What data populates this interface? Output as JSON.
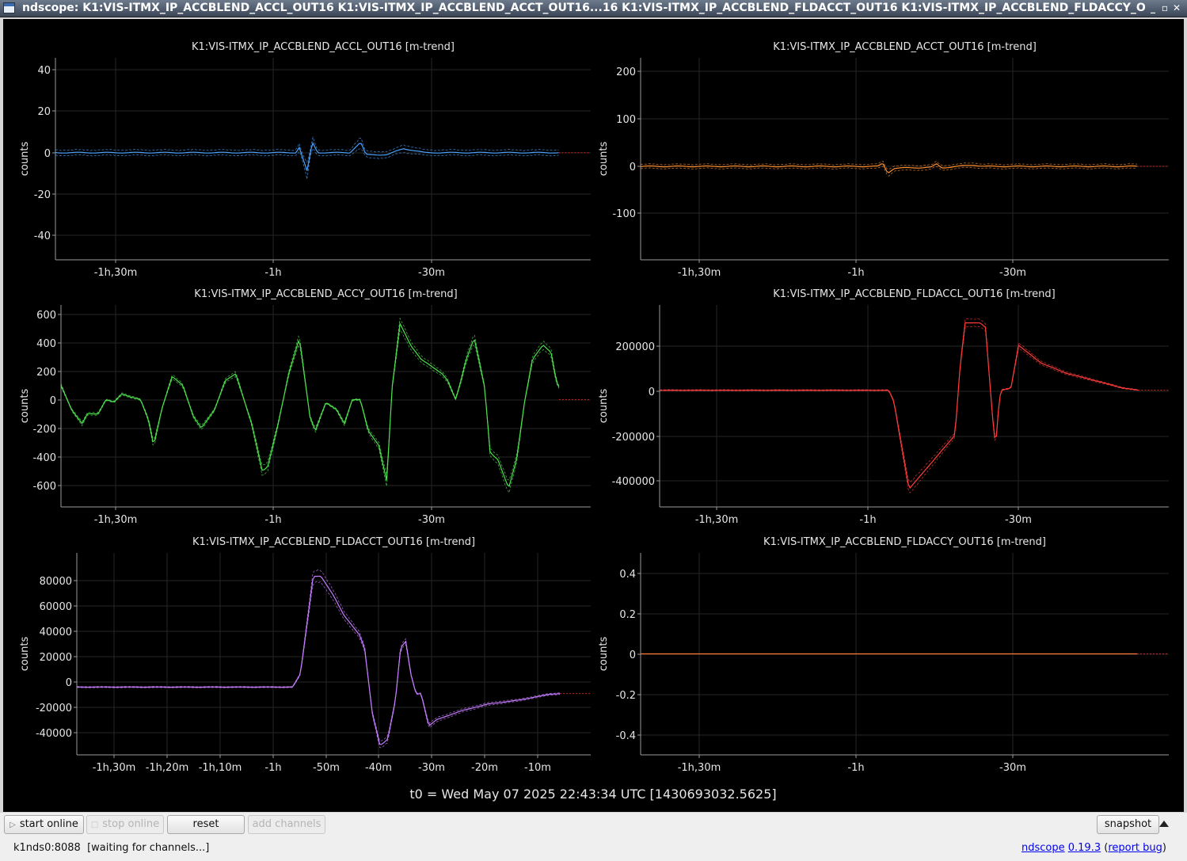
{
  "window": {
    "title": "ndscope: K1:VIS-ITMX_IP_ACCBLEND_ACCL_OUT16 K1:VIS-ITMX_IP_ACCBLEND_ACCT_OUT16...16 K1:VIS-ITMX_IP_ACCBLEND_FLDACCT_OUT16 K1:VIS-ITMX_IP_ACCBLEND_FLDACCY_OUT16",
    "minimize_glyph": "_",
    "maximize_glyph": "▫",
    "close_glyph": "✕",
    "icon": "app-window-icon"
  },
  "plots": [
    {
      "id": "accl",
      "title": "K1:VIS-ITMX_IP_ACCBLEND_ACCL_OUT16 [m-trend]",
      "ylabel": "counts",
      "color": "#4aa3ff",
      "yticks": [
        {
          "v": 40,
          "label": "40"
        },
        {
          "v": 20,
          "label": "20"
        },
        {
          "v": 0,
          "label": "0"
        },
        {
          "v": -20,
          "label": "-20"
        },
        {
          "v": -40,
          "label": "-40"
        }
      ],
      "xticks": [
        "-1h,30m",
        "-1h",
        "-30m"
      ]
    },
    {
      "id": "acct",
      "title": "K1:VIS-ITMX_IP_ACCBLEND_ACCT_OUT16 [m-trend]",
      "ylabel": "counts",
      "color": "#ff8c2a",
      "yticks": [
        {
          "v": 200,
          "label": "200"
        },
        {
          "v": 100,
          "label": "100"
        },
        {
          "v": 0,
          "label": "0"
        },
        {
          "v": -100,
          "label": "-100"
        }
      ],
      "xticks": [
        "-1h,30m",
        "-1h",
        "-30m"
      ]
    },
    {
      "id": "accy",
      "title": "K1:VIS-ITMX_IP_ACCBLEND_ACCY_OUT16 [m-trend]",
      "ylabel": "counts",
      "color": "#4ee04e",
      "yticks": [
        {
          "v": 600,
          "label": "600"
        },
        {
          "v": 400,
          "label": "400"
        },
        {
          "v": 200,
          "label": "200"
        },
        {
          "v": 0,
          "label": "0"
        },
        {
          "v": -200,
          "label": "-200"
        },
        {
          "v": -400,
          "label": "-400"
        },
        {
          "v": -600,
          "label": "-600"
        }
      ],
      "xticks": [
        "-1h,30m",
        "-1h",
        "-30m"
      ]
    },
    {
      "id": "fldaccl",
      "title": "K1:VIS-ITMX_IP_ACCBLEND_FLDACCL_OUT16 [m-trend]",
      "ylabel": "counts",
      "color": "#ff3b3b",
      "yticks": [
        {
          "v": 200000,
          "label": "200000"
        },
        {
          "v": 0,
          "label": "0"
        },
        {
          "v": -200000,
          "label": "-200000"
        },
        {
          "v": -400000,
          "label": "-400000"
        }
      ],
      "xticks": [
        "-1h,30m",
        "-1h",
        "-30m"
      ]
    },
    {
      "id": "fldacct",
      "title": "K1:VIS-ITMX_IP_ACCBLEND_FLDACCT_OUT16 [m-trend]",
      "ylabel": "counts",
      "color": "#c77dff",
      "yticks": [
        {
          "v": 80000,
          "label": "80000"
        },
        {
          "v": 60000,
          "label": "60000"
        },
        {
          "v": 40000,
          "label": "40000"
        },
        {
          "v": 20000,
          "label": "20000"
        },
        {
          "v": 0,
          "label": "0"
        },
        {
          "v": -20000,
          "label": "-20000"
        },
        {
          "v": -40000,
          "label": "-40000"
        }
      ],
      "xticks": [
        "-1h,30m",
        "-1h,20m",
        "-1h,10m",
        "-1h",
        "-50m",
        "-40m",
        "-30m",
        "-20m",
        "-10m"
      ]
    },
    {
      "id": "fldaccy",
      "title": "K1:VIS-ITMX_IP_ACCBLEND_FLDACCY_OUT16 [m-trend]",
      "ylabel": "counts",
      "color": "#ff7a3a",
      "yticks": [
        {
          "v": 0.4,
          "label": "0.4"
        },
        {
          "v": 0.2,
          "label": "0.2"
        },
        {
          "v": 0,
          "label": "0"
        },
        {
          "v": -0.2,
          "label": "-0.2"
        },
        {
          "v": -0.4,
          "label": "-0.4"
        }
      ],
      "xticks": [
        "-1h,30m",
        "-1h",
        "-30m"
      ]
    }
  ],
  "t0_label": "t0 = Wed May 07 2025 22:43:34 UTC [1430693032.5625]",
  "toolbar": {
    "start_online": "start online",
    "stop_online": "stop online",
    "reset": "reset",
    "add_channels": "add channels",
    "snapshot": "snapshot"
  },
  "status": {
    "server": "k1nds0:8088",
    "message": "[waiting for channels...]",
    "app_link": "ndscope",
    "version_link": "0.19.3",
    "bug_link": "report bug"
  }
}
